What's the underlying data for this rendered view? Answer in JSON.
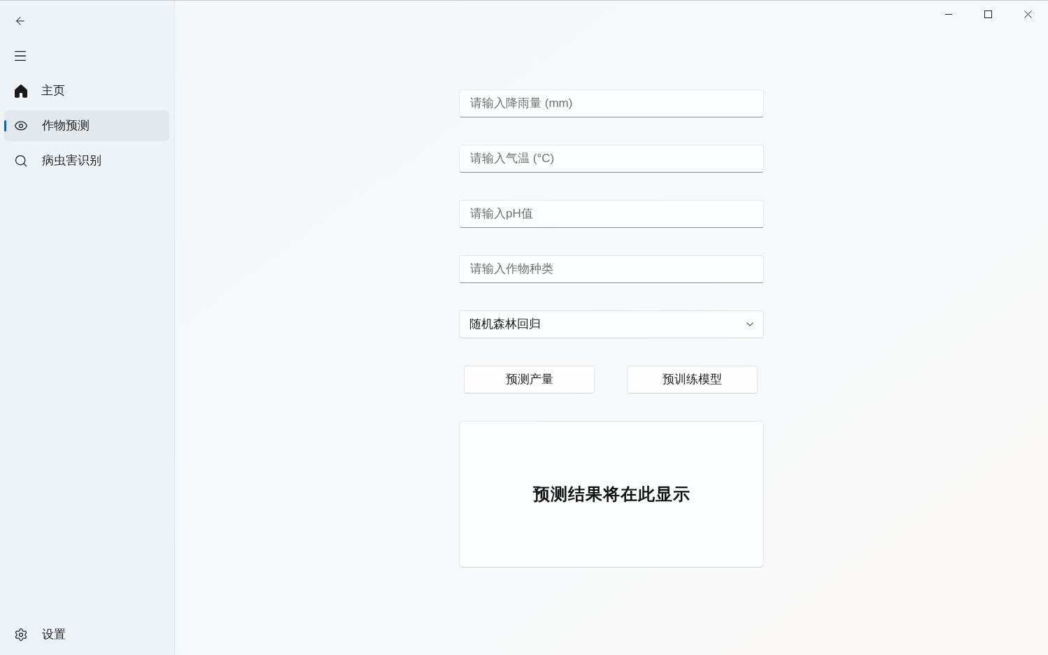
{
  "sidebar": {
    "items": [
      {
        "label": "主页",
        "selected": false
      },
      {
        "label": "作物预测",
        "selected": true
      },
      {
        "label": "病虫害识别",
        "selected": false
      }
    ],
    "footer_items": [
      {
        "label": "设置",
        "selected": false
      }
    ]
  },
  "form": {
    "fields": [
      {
        "placeholder": "请输入降雨量 (mm)"
      },
      {
        "placeholder": "请输入气温 (°C)"
      },
      {
        "placeholder": "请输入pH值"
      },
      {
        "placeholder": "请输入作物种类"
      }
    ],
    "model_select": {
      "value": "随机森林回归"
    },
    "buttons": [
      "预测产量",
      "预训练模型"
    ],
    "result": {
      "text": "预测结果将在此显示"
    }
  }
}
